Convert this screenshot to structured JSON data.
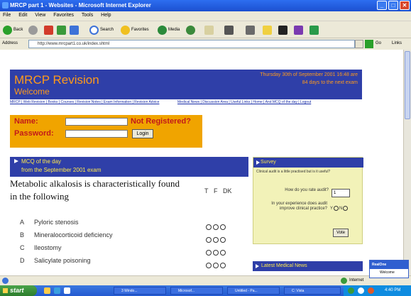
{
  "window": {
    "title": "MRCP part 1 - Websites - Microsoft Internet Explorer"
  },
  "menu": [
    "File",
    "Edit",
    "View",
    "Favorites",
    "Tools",
    "Help"
  ],
  "toolbar": {
    "back": "Back",
    "search": "Search",
    "favorites": "Favorites",
    "media": "Media"
  },
  "address": {
    "label": "Address",
    "url": "http://www.mrcpart1.co.uk/index.shtml",
    "go": "Go",
    "links": "Links"
  },
  "site": {
    "title": "MRCP Revision",
    "welcome": "Welcome",
    "date_line": "Thursday 30th of September 2001 16:48 are",
    "days_line": "84 days to the next exam",
    "nav_left": "MRCP | Web Revision | Books | Courses | Revision Notes | Exam Information | Revision Advice",
    "nav_right": "Medical News | Discussion Area | Useful Links | Home | And MCQ of the day | Logout"
  },
  "login": {
    "name_label": "Name:",
    "password_label": "Password:",
    "not_registered": "Not Registered?",
    "login_button": "Login"
  },
  "mcq": {
    "head_line1": "MCQ of the day",
    "head_line2": "from the September 2001 exam",
    "question": "Metabolic alkalosis is characteristically found in the following",
    "col_t": "T",
    "col_f": "F",
    "col_dk": "DK",
    "options": [
      {
        "letter": "A",
        "text": "Pyloric stenosis"
      },
      {
        "letter": "B",
        "text": "Mineralocorticoid deficiency"
      },
      {
        "letter": "C",
        "text": "Ileostomy"
      },
      {
        "letter": "D",
        "text": "Salicylate poisoning"
      }
    ]
  },
  "survey": {
    "head": "Survey",
    "intro": "Clinical audit is a little practised but is it useful?",
    "q1": "How do you rate audit?",
    "q1_value": "1",
    "q2": "In your experience does audit improve clinical practice?",
    "yes": "Y",
    "no": "N",
    "vote": "Vote"
  },
  "latest": {
    "head": "Latest Medical News"
  },
  "status": {
    "zone": "Internet"
  },
  "popup": {
    "line1": "RealOne",
    "line2": "Welcome"
  },
  "taskbar": {
    "start": "start",
    "tasks": [
      "3 Windo...",
      "Microsof...",
      "Untitled - Pa...",
      "C: Vista"
    ],
    "clock": "4:40 PM"
  }
}
